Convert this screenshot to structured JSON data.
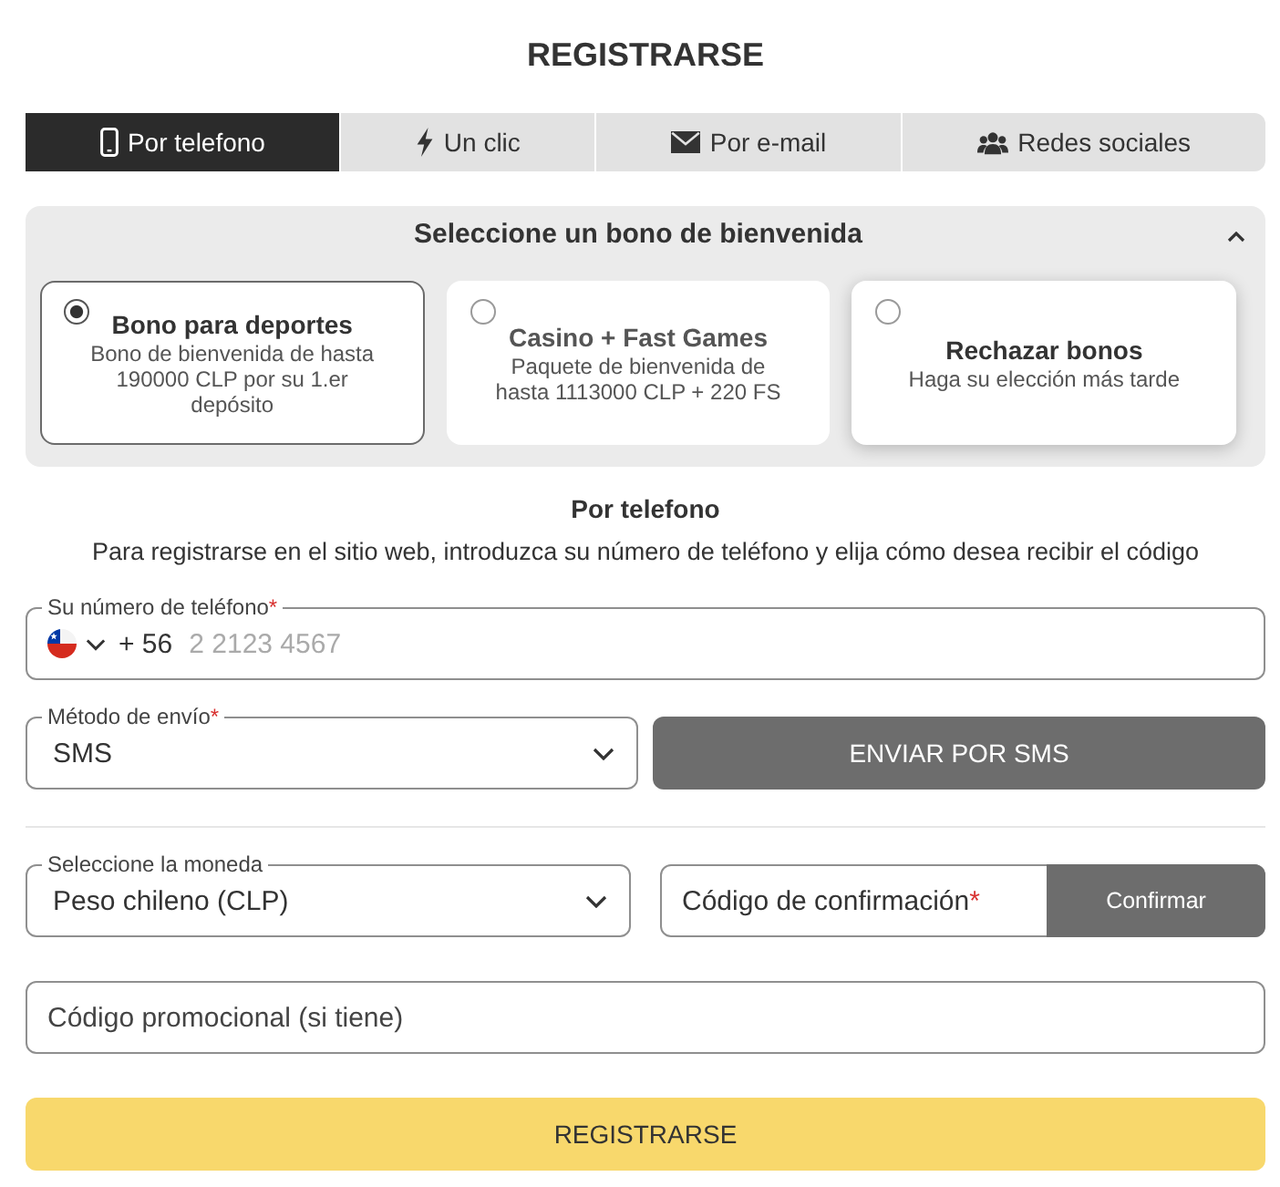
{
  "title": "REGISTRARSE",
  "tabs": [
    {
      "label": "Por telefono",
      "selected": true
    },
    {
      "label": "Un clic",
      "selected": false
    },
    {
      "label": "Por e-mail",
      "selected": false
    },
    {
      "label": "Redes sociales",
      "selected": false
    }
  ],
  "bonus_panel": {
    "heading": "Seleccione un bono de bienvenida",
    "expanded": true,
    "options": [
      {
        "title": "Bono para deportes",
        "description": "Bono de bienvenida de hasta 190000 CLP por su 1.er depósito",
        "selected": true,
        "hovered": false
      },
      {
        "title": "Casino + Fast Games",
        "description": "Paquete de bienvenida de hasta 1113000 CLP + 220 FS",
        "selected": false,
        "hovered": false
      },
      {
        "title": "Rechazar bonos",
        "description": "Haga su elección más tarde",
        "selected": false,
        "hovered": true
      }
    ]
  },
  "phone_section": {
    "heading": "Por telefono",
    "description": "Para registrarse en el sitio web, introduzca su número de teléfono y elija cómo desea recibir el código"
  },
  "phone_number": {
    "label": "Su número de teléfono",
    "required_mark": "*",
    "country_code": "+ 56",
    "placeholder": "2 2123 4567"
  },
  "delivery_method": {
    "label": "Método de envío",
    "required_mark": "*",
    "value": "SMS"
  },
  "send_button": {
    "label": "ENVIAR POR SMS"
  },
  "currency": {
    "label": "Seleccione la moneda",
    "value": "Peso chileno (CLP)"
  },
  "confirmation_code": {
    "label": "Código de confirmación",
    "required_mark": "*",
    "button": "Confirmar"
  },
  "promo_code": {
    "placeholder": "Código promocional (si tiene)"
  },
  "submit_button": {
    "label": "REGISTRARSE"
  }
}
